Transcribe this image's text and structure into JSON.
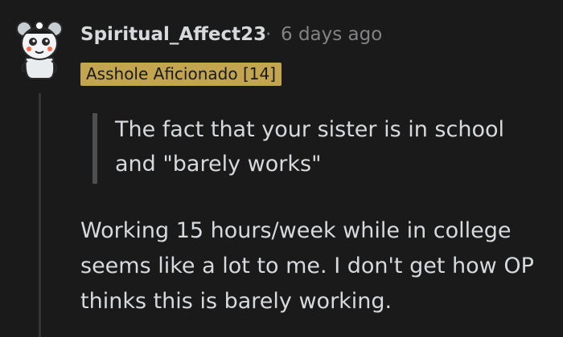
{
  "comment": {
    "username": "Spiritual_Affect23",
    "separator": "·",
    "timestamp": "6 days ago",
    "flair": "Asshole Aficionado [14]",
    "quote": "The fact that your sister is in school and \"barely works\"",
    "body": "Working 15 hours/week while in college seems like a lot to me. I don't get how OP thinks this is barely working."
  },
  "colors": {
    "background": "#1a1a1b",
    "text": "#d7dadc",
    "meta": "#818384",
    "flair_bg": "#c3a550",
    "quote_bar": "#4e4f50",
    "thread_line": "#343536"
  },
  "icons": {
    "avatar": "snoo-avatar-icon"
  }
}
